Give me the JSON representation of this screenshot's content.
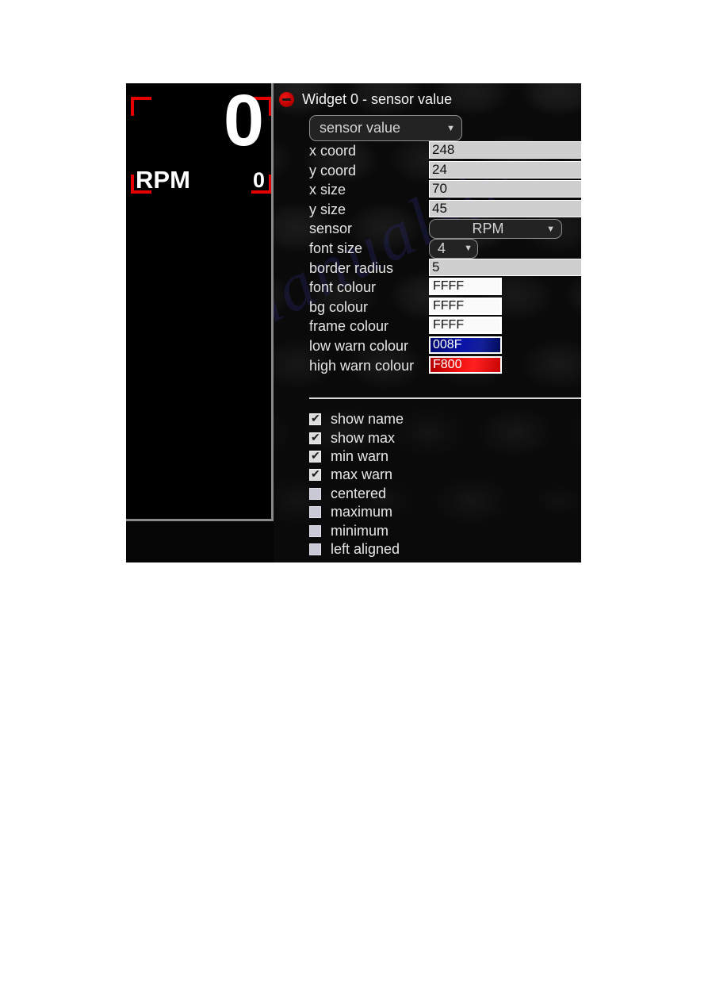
{
  "window": {
    "title": "Widget 0 - sensor value",
    "remove_icon": "remove-circle-icon",
    "help_label": "?"
  },
  "preview": {
    "value": "0",
    "name": "RPM",
    "max_value": "0",
    "frame_colour": "#e60000"
  },
  "type_select": {
    "value": "sensor value",
    "caret": "▼"
  },
  "fields": [
    {
      "label": "x coord",
      "value": "248",
      "control": "text"
    },
    {
      "label": "y coord",
      "value": "24",
      "control": "text"
    },
    {
      "label": "x size",
      "value": "70",
      "control": "text"
    },
    {
      "label": "y size",
      "value": "45",
      "control": "text"
    },
    {
      "label": "sensor",
      "value": "RPM",
      "control": "select-sensor"
    },
    {
      "label": "font size",
      "value": "4",
      "control": "select-fontsize"
    },
    {
      "label": "border radius",
      "value": "5",
      "control": "text"
    },
    {
      "label": "font colour",
      "value": "FFFF",
      "control": "swatch"
    },
    {
      "label": "bg colour",
      "value": "FFFF",
      "control": "swatch"
    },
    {
      "label": "frame colour",
      "value": "FFFF",
      "control": "swatch"
    },
    {
      "label": "low warn colour",
      "value": "008F",
      "control": "swatch-low"
    },
    {
      "label": "high warn colour",
      "value": "F800",
      "control": "swatch-high"
    }
  ],
  "checkboxes": [
    {
      "label": "show name",
      "checked": true
    },
    {
      "label": "show max",
      "checked": true
    },
    {
      "label": "min warn",
      "checked": true
    },
    {
      "label": "max warn",
      "checked": true
    },
    {
      "label": "centered",
      "checked": false
    },
    {
      "label": "maximum",
      "checked": false
    },
    {
      "label": "minimum",
      "checked": false
    },
    {
      "label": "left aligned",
      "checked": false
    }
  ],
  "watermark": {
    "text": "manualslive.com"
  },
  "colors": {
    "accent_red": "#c00000",
    "low_warn": "#0a14a8",
    "high_warn": "#f01010",
    "panel_bg": "#0a0a0a"
  }
}
